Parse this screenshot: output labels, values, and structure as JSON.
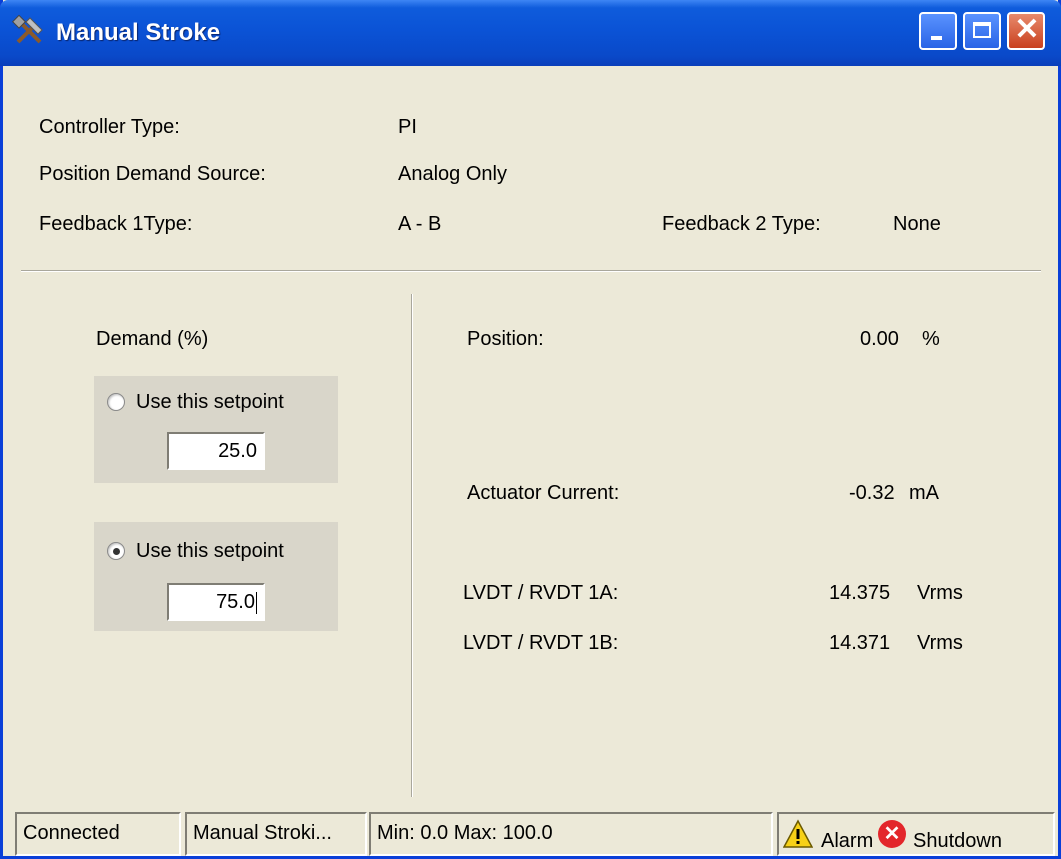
{
  "window": {
    "title": "Manual Stroke",
    "icon": "tools-icon"
  },
  "controller": {
    "type_label": "Controller Type:",
    "type_value": "PI",
    "demand_source_label": "Position Demand Source:",
    "demand_source_value": "Analog Only",
    "feedback1_label": "Feedback 1Type:",
    "feedback1_value": "A - B",
    "feedback2_label": "Feedback 2 Type:",
    "feedback2_value": "None"
  },
  "demand": {
    "title": "Demand (%)",
    "setpoints": [
      {
        "label": "Use this setpoint",
        "value": "25.0",
        "selected": false
      },
      {
        "label": "Use this setpoint",
        "value": "75.0",
        "selected": true
      }
    ]
  },
  "readouts": {
    "position_label": "Position:",
    "position_value": "0.00",
    "position_unit": "%",
    "current_label": "Actuator Current:",
    "current_value": "-0.32",
    "current_unit": "mA",
    "lvdt1a_label": "LVDT / RVDT 1A:",
    "lvdt1a_value": "14.375",
    "lvdt1a_unit": "Vrms",
    "lvdt1b_label": "LVDT / RVDT 1B:",
    "lvdt1b_value": "14.371",
    "lvdt1b_unit": "Vrms"
  },
  "status": {
    "connection": "Connected",
    "mode": "Manual Stroki...",
    "range": "Min: 0.0 Max: 100.0",
    "alarm": "Alarm",
    "shutdown": "Shutdown"
  },
  "colors": {
    "title_bar": "#0a53d6",
    "window_bg": "#ece9d8",
    "group_bg": "#d9d6ca",
    "alarm_yellow": "#f7d117",
    "shutdown_red": "#e3262b"
  }
}
